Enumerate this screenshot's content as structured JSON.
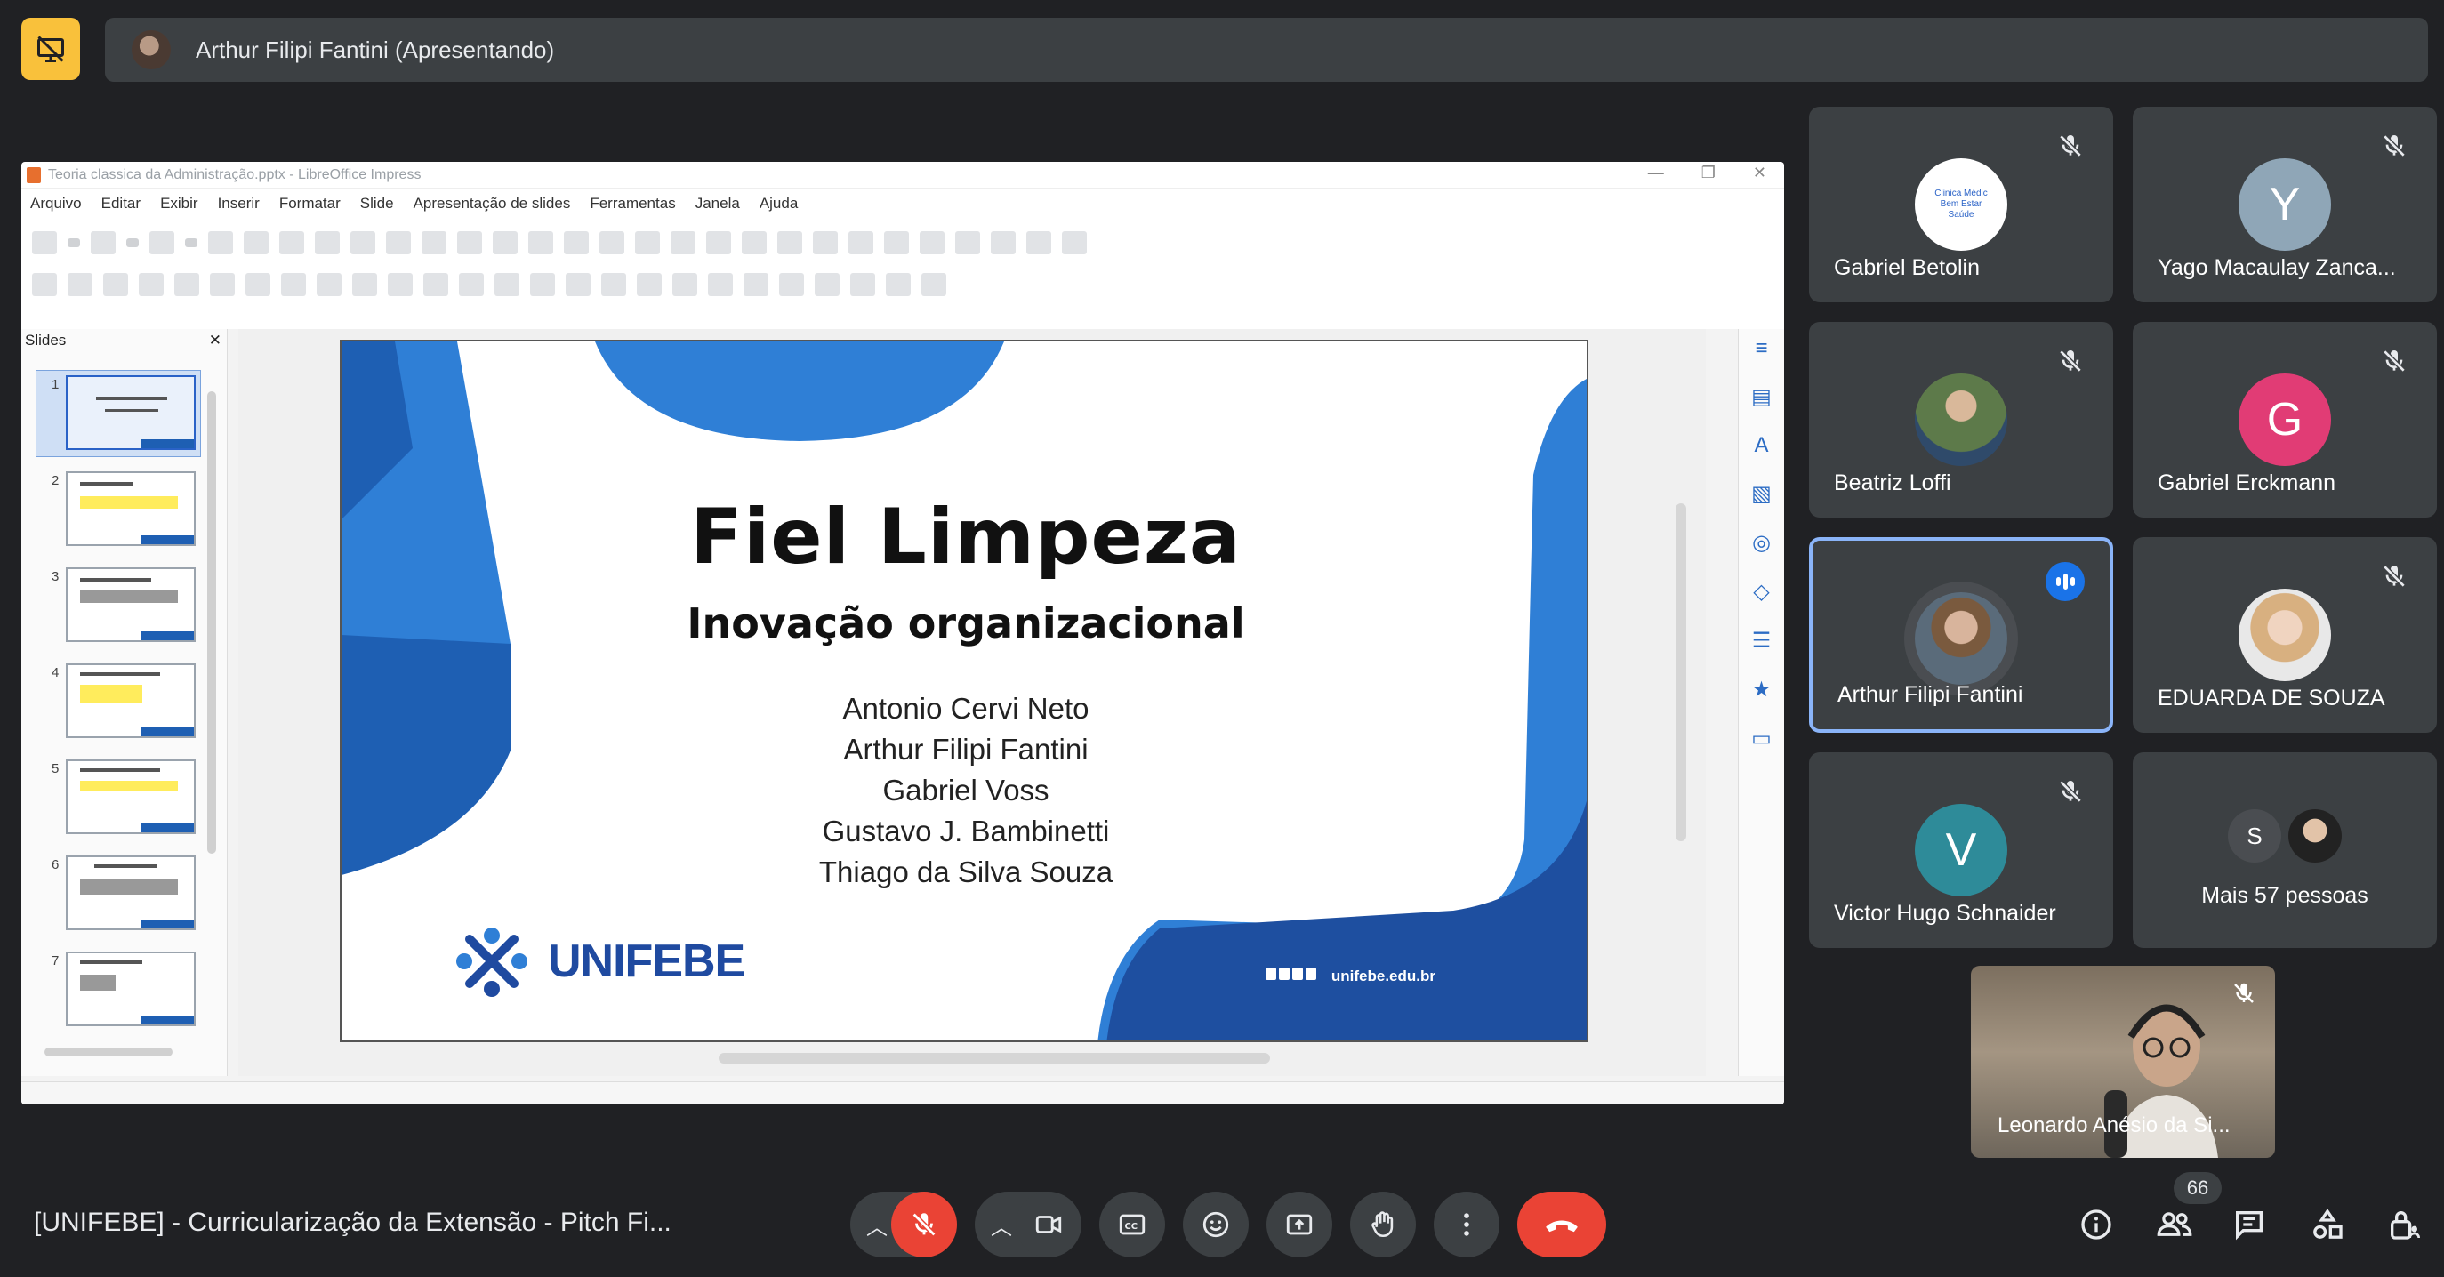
{
  "top": {
    "presenter_name": "Arthur Filipi Fantini (Apresentando)"
  },
  "window": {
    "title": "Teoria classica da Administração.pptx - LibreOffice Impress",
    "menu": [
      "Arquivo",
      "Editar",
      "Exibir",
      "Inserir",
      "Formatar",
      "Slide",
      "Apresentação de slides",
      "Ferramentas",
      "Janela",
      "Ajuda"
    ],
    "slides_pane_title": "Slides",
    "slide_numbers": [
      "1",
      "2",
      "3",
      "4",
      "5",
      "6",
      "7"
    ]
  },
  "slide": {
    "title": "Fiel Limpeza",
    "subtitle": "Inovação organizacional",
    "authors": [
      "Antonio Cervi Neto",
      "Arthur Filipi Fantini",
      "Gabriel Voss",
      "Gustavo J. Bambinetti",
      "Thiago da Silva Souza"
    ],
    "logo_text": "UNIFEBE",
    "website": "unifebe.edu.br"
  },
  "participants": [
    {
      "name": "Gabriel Betolin",
      "avatar": "photo-clinic-logo",
      "muted": true
    },
    {
      "name": "Yago Macaulay Zanca...",
      "initial": "Y",
      "color": "#8fa6b7",
      "muted": true
    },
    {
      "name": "Beatriz Loffi",
      "avatar": "photo",
      "muted": true
    },
    {
      "name": "Gabriel Erckmann",
      "initial": "G",
      "color": "#e13c75",
      "muted": true
    },
    {
      "name": "Arthur Filipi Fantini",
      "avatar": "photo",
      "speaking": true
    },
    {
      "name": "EDUARDA DE SOUZA",
      "avatar": "photo",
      "muted": true
    },
    {
      "name": "Victor Hugo Schnaider",
      "initial": "V",
      "color": "#2e8b99",
      "muted": true
    },
    {
      "name": "Mais 57 pessoas",
      "initial": "S"
    }
  ],
  "self_view": {
    "name": "Leonardo Anésio da Si..."
  },
  "clinic_logo": {
    "line1": "Clinica Médic",
    "line2": "Bem Estar",
    "line3": "Saúde"
  },
  "bottom": {
    "meeting_title": "[UNIFEBE] - Curricularização da Extensão - Pitch Fi...",
    "participant_count": "66"
  },
  "colors": {
    "accent": "#8ab4f8",
    "end_call": "#ea4335",
    "stop_present": "#f9c13b",
    "brand_blue": "#1f4aa0"
  }
}
